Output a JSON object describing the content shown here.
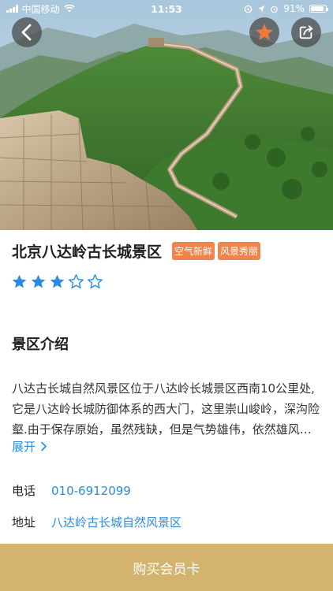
{
  "status_bar": {
    "carrier": "中国移动",
    "time": "11:53",
    "battery": "91%",
    "battery_level": 0.91
  },
  "nav": {
    "back_icon": "chevron-left-icon",
    "favorite_icon": "star-icon",
    "share_icon": "share-icon",
    "favorite_color": "#f07a3c"
  },
  "attraction": {
    "title": "北京八达岭古长城景区",
    "tags": [
      "空气新鲜",
      "风景秀丽"
    ],
    "rating": 3,
    "rating_max": 5
  },
  "intro": {
    "heading": "景区介绍",
    "text": "八达古长城自然风景区位于八达岭长城景区西南10公里处,它是八达岭长城防御体系的西大门，这里崇山峻岭，深沟险壑.由于保存原始，虽然残缺，但是气势雄伟，依然雄风犹存。",
    "expand_label": "展开"
  },
  "contact": {
    "phone_label": "电话",
    "phone_value": "010-6912099",
    "address_label": "地址",
    "address_value": "八达岭古长城自然风景区"
  },
  "footer": {
    "buy_label": "购买会员卡"
  },
  "colors": {
    "tag_bg": "#f0844a",
    "star": "#2a8be0",
    "link": "#2a8be0",
    "buy_bar": "#d4b36e"
  }
}
